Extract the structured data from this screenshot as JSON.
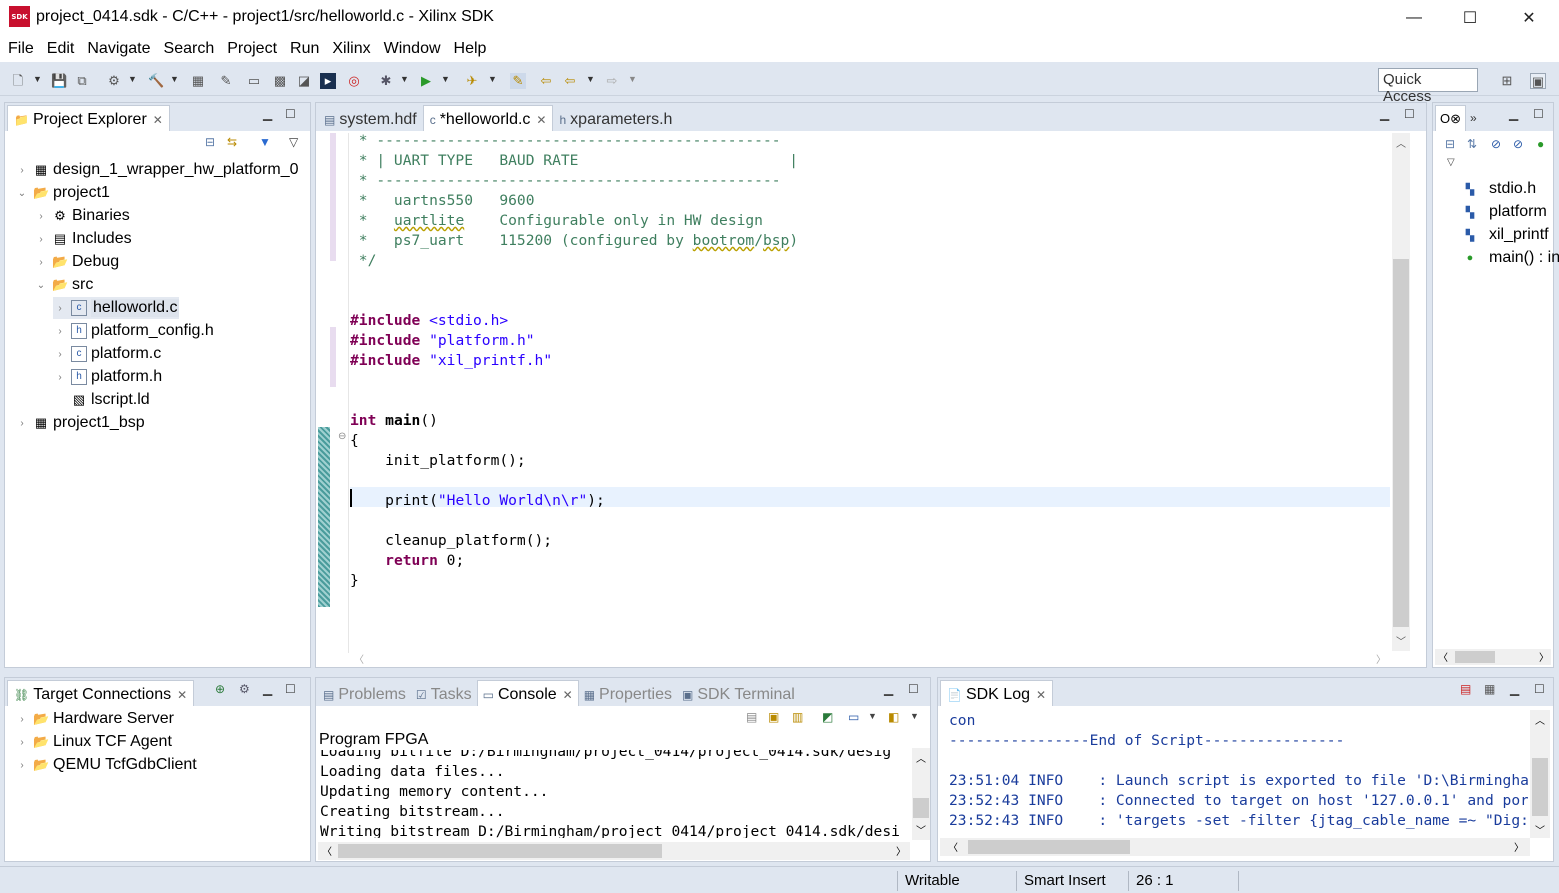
{
  "window": {
    "title": "project_0414.sdk - C/C++ - project1/src/helloworld.c - Xilinx SDK",
    "logo_text": "SDK",
    "minimize": "—",
    "maximize": "☐",
    "close": "✕"
  },
  "menu": [
    "File",
    "Edit",
    "Navigate",
    "Search",
    "Project",
    "Run",
    "Xilinx",
    "Window",
    "Help"
  ],
  "toolbar": {
    "quick_access": "Quick Access"
  },
  "project_explorer": {
    "tab_label": "Project Explorer",
    "items": [
      {
        "label": "design_1_wrapper_hw_platform_0",
        "indent": 0,
        "twisty": "›",
        "icon": "hw-platform-icon"
      },
      {
        "label": "project1",
        "indent": 0,
        "twisty": "⌄",
        "icon": "c-project-icon"
      },
      {
        "label": "Binaries",
        "indent": 1,
        "twisty": "›",
        "icon": "binaries-icon"
      },
      {
        "label": "Includes",
        "indent": 1,
        "twisty": "›",
        "icon": "includes-icon"
      },
      {
        "label": "Debug",
        "indent": 1,
        "twisty": "›",
        "icon": "folder-icon"
      },
      {
        "label": "src",
        "indent": 1,
        "twisty": "⌄",
        "icon": "folder-icon"
      },
      {
        "label": "helloworld.c",
        "indent": 2,
        "twisty": "›",
        "icon": "c-file-icon",
        "selected": true
      },
      {
        "label": "platform_config.h",
        "indent": 2,
        "twisty": "›",
        "icon": "h-file-icon"
      },
      {
        "label": "platform.c",
        "indent": 2,
        "twisty": "›",
        "icon": "c-file-icon"
      },
      {
        "label": "platform.h",
        "indent": 2,
        "twisty": "›",
        "icon": "h-file-icon"
      },
      {
        "label": "lscript.ld",
        "indent": 2,
        "twisty": "",
        "icon": "linker-script-icon"
      },
      {
        "label": "project1_bsp",
        "indent": 0,
        "twisty": "›",
        "icon": "bsp-project-icon"
      }
    ]
  },
  "editor": {
    "tabs": [
      {
        "label": "system.hdf",
        "icon": "hdf",
        "active": false
      },
      {
        "label": "*helloworld.c",
        "icon": "c",
        "active": true
      },
      {
        "label": "xparameters.h",
        "icon": "h",
        "active": false
      }
    ],
    "lines": [
      {
        "html": "<span class=\"cmt\"> * ----------------------------------------------</span>"
      },
      {
        "html": "<span class=\"cmt\"> * | UART TYPE   BAUD RATE                        |</span>"
      },
      {
        "html": "<span class=\"cmt\"> * ----------------------------------------------</span>"
      },
      {
        "html": "<span class=\"cmt\"> *   uartns550   9600</span>"
      },
      {
        "html": "<span class=\"cmt\"> *   <span class=\"squig\">uartlite</span>    Configurable only in HW design</span>"
      },
      {
        "html": "<span class=\"cmt\"> *   ps7_uart    115200 (configured by <span class=\"squig\">bootrom</span>/<span class=\"squig\">bsp</span>)</span>"
      },
      {
        "html": "<span class=\"cmt\"> */</span>"
      },
      {
        "html": ""
      },
      {
        "html": ""
      },
      {
        "html": "<span class=\"kw\">#include</span> <span class=\"str\">&lt;stdio.h&gt;</span>"
      },
      {
        "html": "<span class=\"kw\">#include</span> <span class=\"str\">\"platform.h\"</span>"
      },
      {
        "html": "<span class=\"kw\">#include</span> <span class=\"str\">\"xil_printf.h\"</span>"
      },
      {
        "html": ""
      },
      {
        "html": ""
      },
      {
        "html": "<span class=\"kw\">int</span> <span class=\"fn\">main</span>()"
      },
      {
        "html": "{"
      },
      {
        "html": "    init_platform();"
      },
      {
        "html": ""
      },
      {
        "html": "    print(<span class=\"str\">\"Hello World\\n\\r\"</span>);"
      },
      {
        "html": ""
      },
      {
        "html": "    cleanup_platform();"
      },
      {
        "html": "    <span class=\"kw\">return</span> 0;"
      },
      {
        "html": "}"
      }
    ]
  },
  "outline": {
    "items": [
      {
        "label": "stdio.h",
        "icon": "include-icon"
      },
      {
        "label": "platform",
        "icon": "include-icon"
      },
      {
        "label": "xil_printf",
        "icon": "include-icon"
      },
      {
        "label": "main() : in",
        "icon": "function-icon"
      }
    ]
  },
  "target_connections": {
    "tab_label": "Target Connections",
    "items": [
      "Hardware Server",
      "Linux TCF Agent",
      "QEMU TcfGdbClient"
    ]
  },
  "console": {
    "tabs": [
      {
        "label": "Problems",
        "active": false
      },
      {
        "label": "Tasks",
        "active": false
      },
      {
        "label": "Console",
        "active": true
      },
      {
        "label": "Properties",
        "active": false
      },
      {
        "label": "SDK Terminal",
        "active": false
      }
    ],
    "title": "Program FPGA",
    "lines": [
      "Loading bitfile D:/Birmingham/project_0414/project_0414.sdk/desig",
      "Loading data files...",
      "Updating memory content...",
      "Creating bitstream...",
      "Writing bitstream D:/Birmingham/project_0414/project_0414.sdk/desi"
    ]
  },
  "sdk_log": {
    "tab_label": "SDK Log",
    "lines": [
      "con",
      "----------------End of Script----------------",
      "",
      "23:51:04 INFO    : Launch script is exported to file 'D:\\Birmingha",
      "23:52:43 INFO    : Connected to target on host '127.0.0.1' and por",
      "23:52:43 INFO    : 'targets -set -filter {jtag_cable_name =~ \"Dig:"
    ]
  },
  "status": {
    "mode": "Writable",
    "insert": "Smart Insert",
    "position": "26 : 1"
  }
}
